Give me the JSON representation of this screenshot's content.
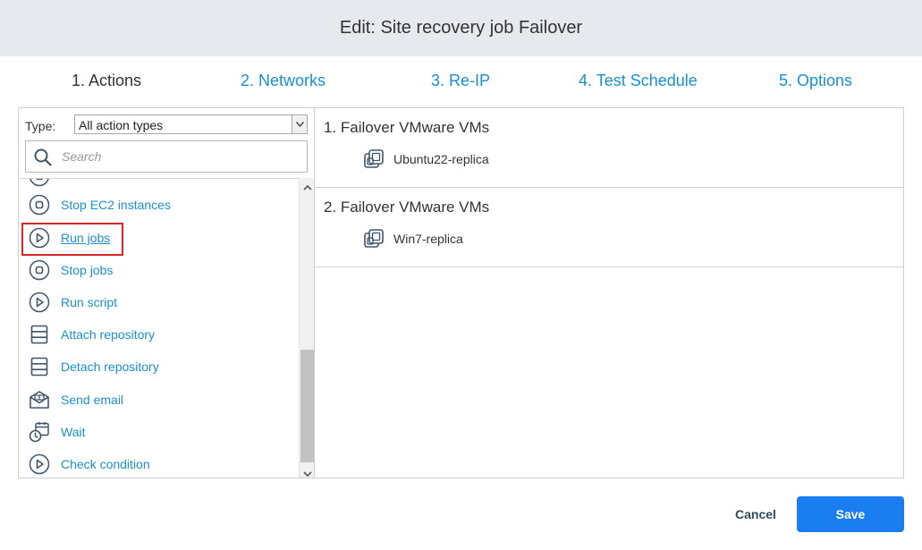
{
  "header": {
    "title": "Edit: Site recovery job Failover"
  },
  "steps": [
    {
      "label": "1. Actions",
      "active": true
    },
    {
      "label": "2. Networks",
      "active": false
    },
    {
      "label": "3. Re-IP",
      "active": false
    },
    {
      "label": "4. Test Schedule",
      "active": false
    },
    {
      "label": "5. Options",
      "active": false
    }
  ],
  "filter": {
    "type_label": "Type:",
    "type_value": "All action types",
    "search_placeholder": "Search"
  },
  "actions": [
    {
      "label": "",
      "icon": "stop-circle-icon"
    },
    {
      "label": "Stop EC2 instances",
      "icon": "stop-circle-icon"
    },
    {
      "label": "Run jobs",
      "icon": "play-circle-icon",
      "selected": true
    },
    {
      "label": "Stop jobs",
      "icon": "stop-circle-icon"
    },
    {
      "label": "Run script",
      "icon": "play-circle-icon"
    },
    {
      "label": "Attach repository",
      "icon": "repository-icon"
    },
    {
      "label": "Detach repository",
      "icon": "repository-icon"
    },
    {
      "label": "Send email",
      "icon": "email-icon"
    },
    {
      "label": "Wait",
      "icon": "wait-clock-icon"
    },
    {
      "label": "Check condition",
      "icon": "play-circle-icon"
    }
  ],
  "job_actions": [
    {
      "title": "1. Failover VMware VMs",
      "vms": [
        "Ubuntu22-replica"
      ]
    },
    {
      "title": "2. Failover VMware VMs",
      "vms": [
        "Win7-replica"
      ]
    }
  ],
  "footer": {
    "cancel_label": "Cancel",
    "save_label": "Save"
  },
  "colors": {
    "accent": "#1a8fd1",
    "primary_button": "#1a7df0",
    "highlight": "#d8262a",
    "icon": "#3e556a"
  }
}
